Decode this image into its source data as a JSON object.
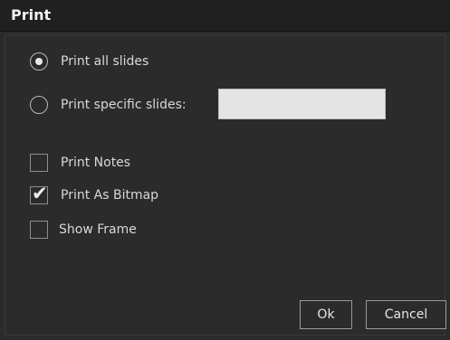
{
  "dialog": {
    "title": "Print"
  },
  "options": {
    "print_all_label": "Print all slides",
    "print_all_selected": true,
    "print_specific_label": "Print specific slides:",
    "print_specific_selected": false,
    "specific_slides_value": ""
  },
  "checkboxes": {
    "print_notes_label": "Print Notes",
    "print_notes_checked": false,
    "print_bitmap_label": "Print As Bitmap",
    "print_bitmap_checked": true,
    "show_frame_label": "Show Frame",
    "show_frame_checked": false
  },
  "buttons": {
    "ok_label": "Ok",
    "cancel_label": "Cancel"
  },
  "colors": {
    "background": "#2b2b2b",
    "titlebar": "#202020",
    "text": "#d8d8d8",
    "input_background": "#e4e4e4"
  },
  "icons": {
    "checkmark": "checkmark-icon"
  }
}
